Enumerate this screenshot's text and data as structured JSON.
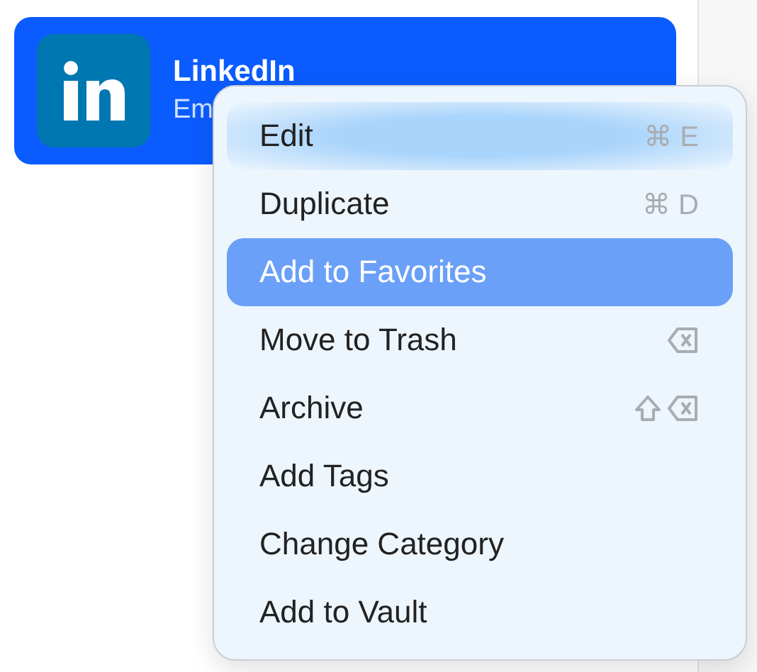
{
  "item": {
    "title": "LinkedIn",
    "subtitle": "Em",
    "selected": true
  },
  "menu": [
    {
      "label": "Edit",
      "hovered": true,
      "selected": false,
      "shortcut": {
        "kind": "keys",
        "text": "⌘ E"
      }
    },
    {
      "label": "Duplicate",
      "hovered": false,
      "selected": false,
      "shortcut": {
        "kind": "keys",
        "text": "⌘ D"
      }
    },
    {
      "label": "Add to Favorites",
      "hovered": false,
      "selected": true
    },
    {
      "label": "Move to Trash",
      "hovered": false,
      "selected": false,
      "shortcut": {
        "kind": "delete"
      }
    },
    {
      "label": "Archive",
      "hovered": false,
      "selected": false,
      "shortcut": {
        "kind": "shift-delete"
      }
    },
    {
      "label": "Add Tags",
      "hovered": false,
      "selected": false
    },
    {
      "label": "Change Category",
      "hovered": false,
      "selected": false
    },
    {
      "label": "Add to Vault",
      "hovered": false,
      "selected": false
    }
  ]
}
